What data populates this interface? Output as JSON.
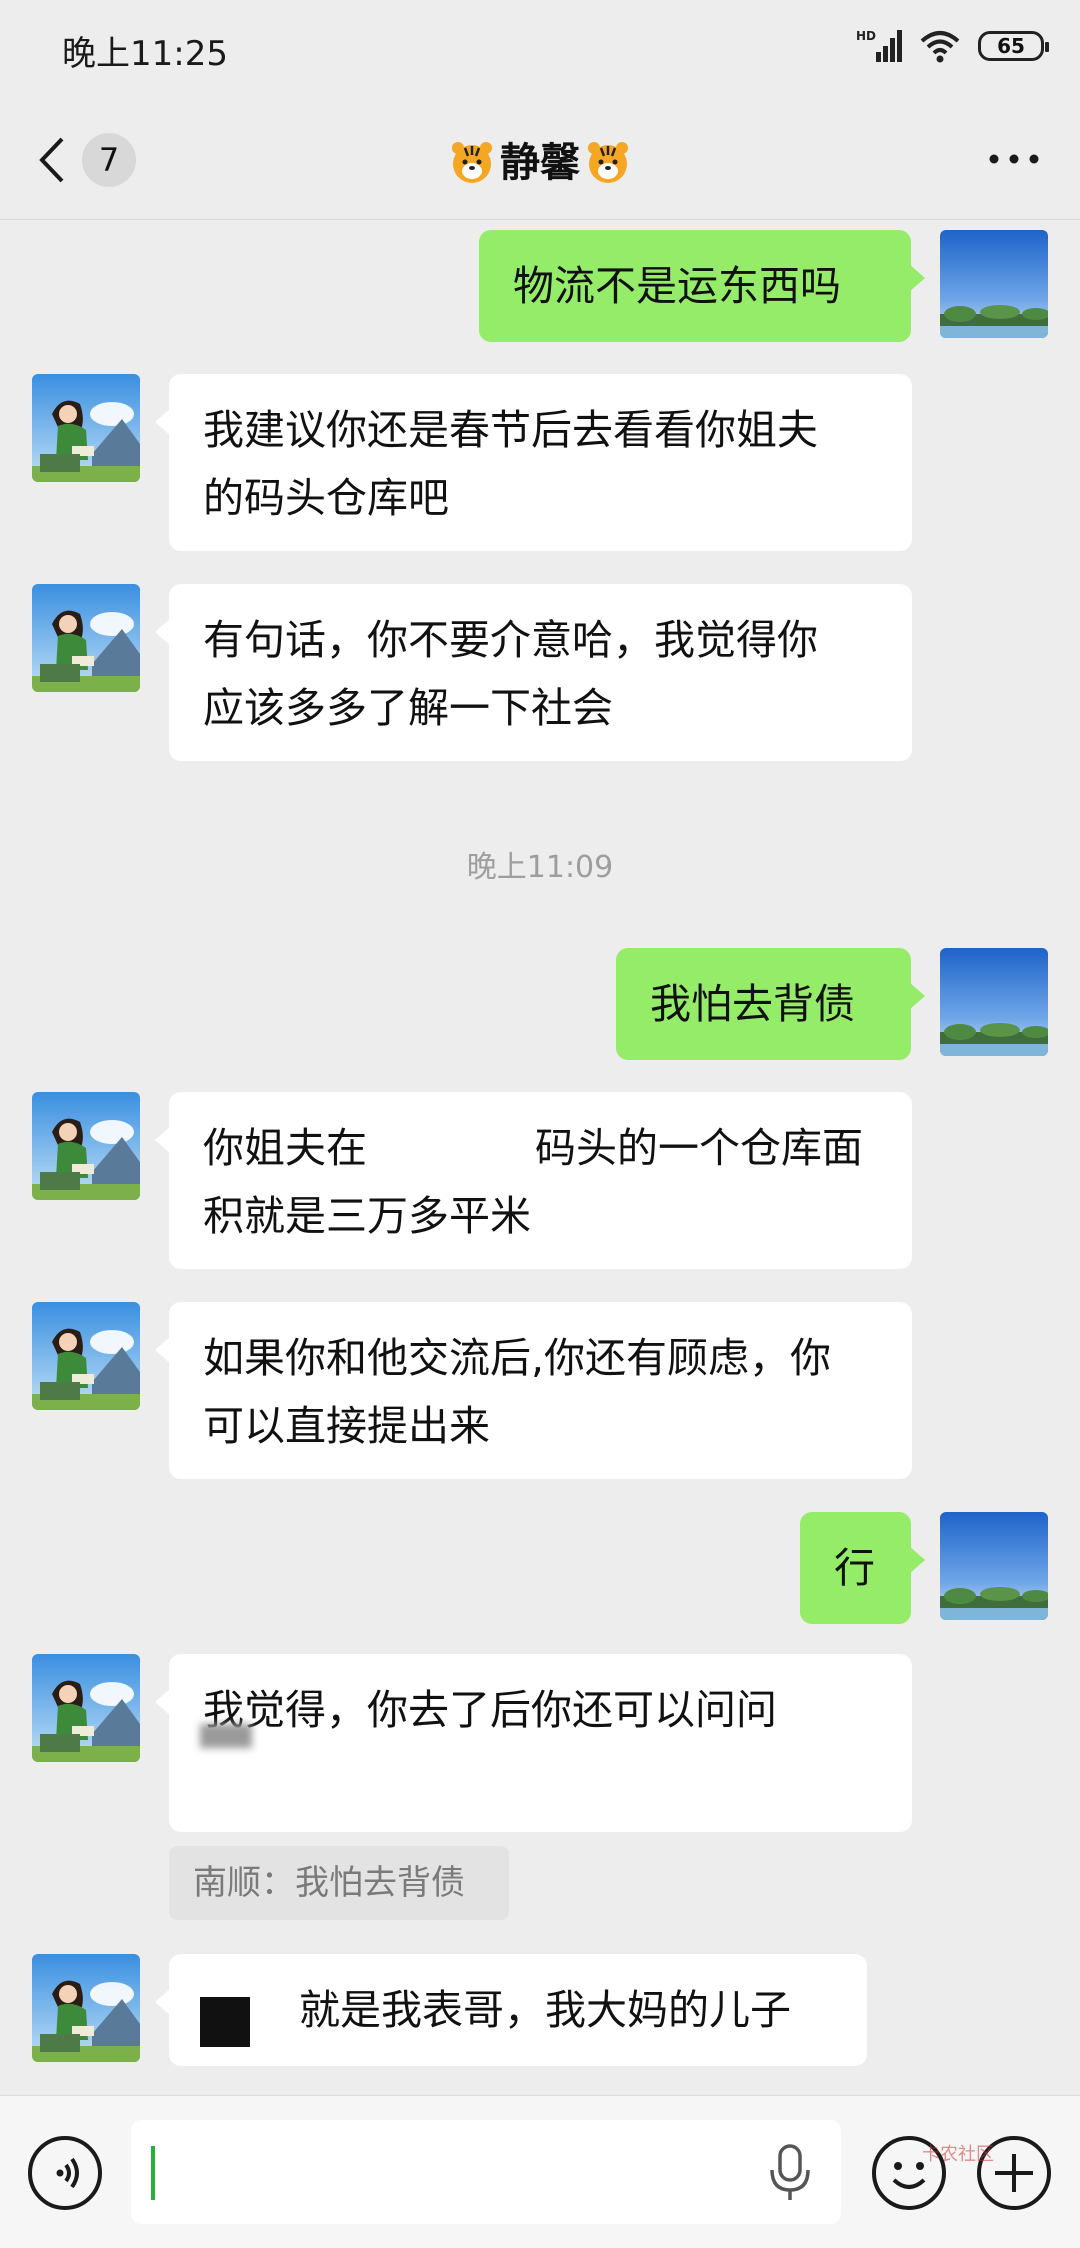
{
  "status_bar": {
    "time": "晚上11:25",
    "network": "HD",
    "battery": "65"
  },
  "header": {
    "unread_count": "7",
    "title": "静馨"
  },
  "messages": [
    {
      "side": "right",
      "text": "物流不是运东西吗"
    },
    {
      "side": "left",
      "lines": [
        "我建议你还是春节后去看看你姐夫",
        "的码头仓库吧"
      ]
    },
    {
      "side": "left",
      "lines": [
        "有句话，你不要介意哈，我觉得你",
        "应该多多了解一下社会"
      ]
    },
    {
      "timestamp": "晚上11:09"
    },
    {
      "side": "right",
      "text": "我怕去背债"
    },
    {
      "side": "left",
      "lines": [
        "你姐夫在",
        "码头的一个仓库面",
        "积就是三万多平米"
      ]
    },
    {
      "side": "left",
      "lines": [
        "如果你和他交流后,你还有顾虑，你",
        "可以直接提出来"
      ]
    },
    {
      "side": "right",
      "text": "行"
    },
    {
      "side": "left",
      "text": "我觉得，你去了后你还可以问问",
      "quote": "南顺：我怕去背债"
    },
    {
      "side": "left",
      "text": "就是我表哥，我大妈的儿子"
    }
  ],
  "watermark": "卡农社区",
  "colors": {
    "background": "#ededed",
    "self_bubble": "#95ec69",
    "other_bubble": "#ffffff",
    "cursor": "#2bae3a"
  },
  "icons": [
    "back-chevron-icon",
    "more-icon",
    "tiger-emoji-icon",
    "voice-icon",
    "mic-icon",
    "emoji-icon",
    "plus-icon",
    "wifi-icon",
    "signal-icon",
    "battery-icon"
  ]
}
